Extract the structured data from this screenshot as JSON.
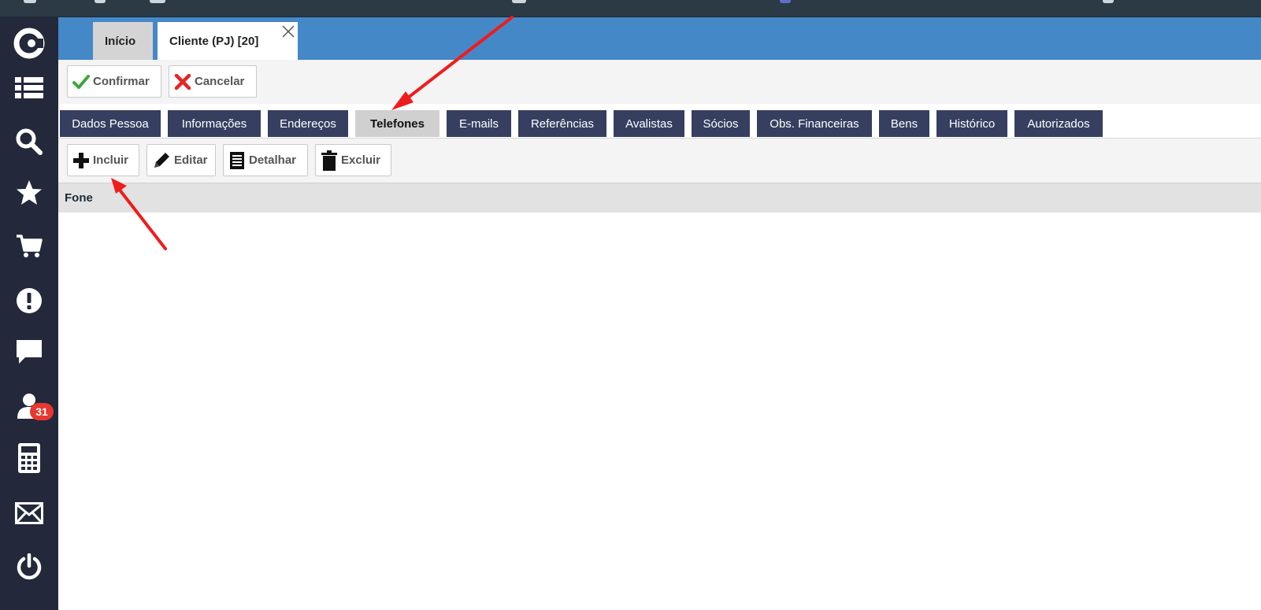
{
  "top_window_tabs": [
    {
      "label": "Início",
      "active": false
    },
    {
      "label": "Cliente (PJ) [20]",
      "active": true,
      "closable": true
    }
  ],
  "actions": {
    "confirm_label": "Confirmar",
    "cancel_label": "Cancelar"
  },
  "section_tabs": [
    {
      "label": "Dados Pessoa",
      "active": false
    },
    {
      "label": "Informações",
      "active": false
    },
    {
      "label": "Endereços",
      "active": false
    },
    {
      "label": "Telefones",
      "active": true
    },
    {
      "label": "E-mails",
      "active": false
    },
    {
      "label": "Referências",
      "active": false
    },
    {
      "label": "Avalistas",
      "active": false
    },
    {
      "label": "Sócios",
      "active": false
    },
    {
      "label": "Obs. Financeiras",
      "active": false
    },
    {
      "label": "Bens",
      "active": false
    },
    {
      "label": "Histórico",
      "active": false
    },
    {
      "label": "Autorizados",
      "active": false
    }
  ],
  "grid_actions": {
    "add_label": "Incluir",
    "edit_label": "Editar",
    "detail_label": "Detalhar",
    "delete_label": "Excluir"
  },
  "grid": {
    "columns": [
      "Fone"
    ],
    "rows": []
  },
  "sidebar": {
    "items": [
      {
        "icon": "logo-icon"
      },
      {
        "icon": "list-icon"
      },
      {
        "icon": "search-icon"
      },
      {
        "icon": "star-icon"
      },
      {
        "icon": "cart-icon"
      },
      {
        "icon": "alert-icon"
      },
      {
        "icon": "chat-icon"
      },
      {
        "icon": "user-icon",
        "badge": "31"
      },
      {
        "icon": "calculator-icon"
      },
      {
        "icon": "mail-icon"
      },
      {
        "icon": "power-icon"
      }
    ]
  },
  "colors": {
    "sidebar": "#23293b",
    "window_tabbar": "#4588c7",
    "section_tab": "#363f60",
    "section_tab_active": "#d0d0d0",
    "badge": "#e8382f",
    "annotation_arrow": "#ee1c1c"
  }
}
